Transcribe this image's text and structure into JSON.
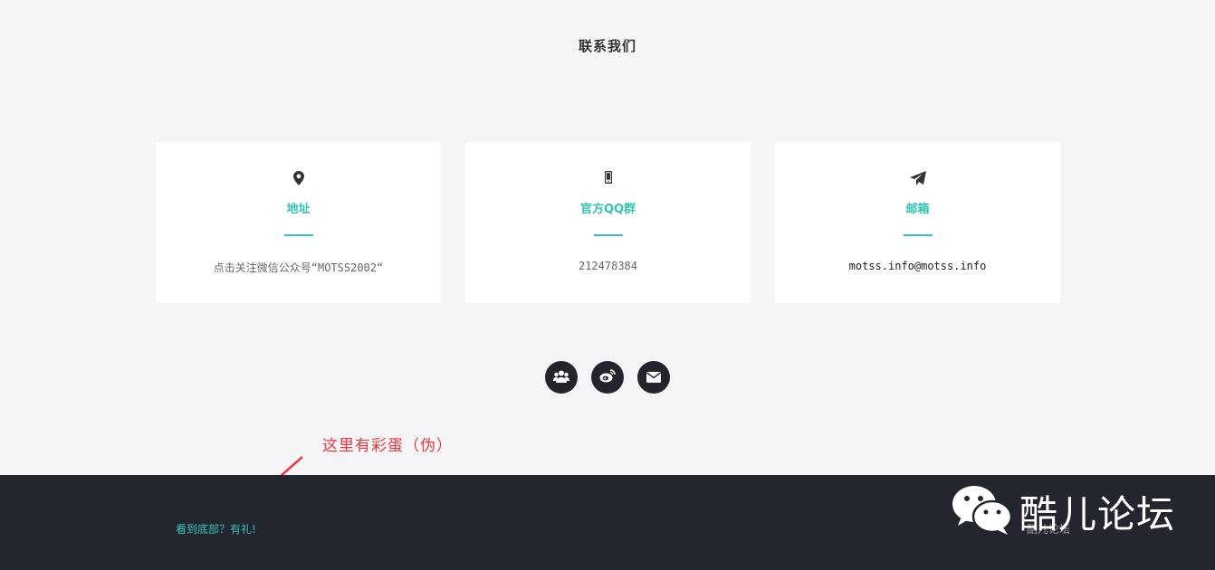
{
  "section": {
    "title": "联系我们"
  },
  "cards": [
    {
      "icon": "map-marker-icon",
      "title": "地址",
      "value": "点击关注微信公众号“MOTSS2002“"
    },
    {
      "icon": "mobile-phone-icon",
      "title": "官方QQ群",
      "value": "212478384"
    },
    {
      "icon": "paper-plane-icon",
      "title": "邮箱",
      "value": "motss.info@motss.info"
    }
  ],
  "social": [
    {
      "icon": "users-group-icon"
    },
    {
      "icon": "weibo-icon"
    },
    {
      "icon": "envelope-icon"
    }
  ],
  "annotation": {
    "text": "这里有彩蛋（伪）"
  },
  "footer": {
    "link": "看到底部？有礼!",
    "right_text": "酷儿论坛",
    "watermark_text": "酷儿论坛"
  },
  "colors": {
    "accent": "#31c5b5",
    "footer_bg": "#23262e",
    "annotation": "#e8383d",
    "page_bg": "#f5f5f7"
  }
}
